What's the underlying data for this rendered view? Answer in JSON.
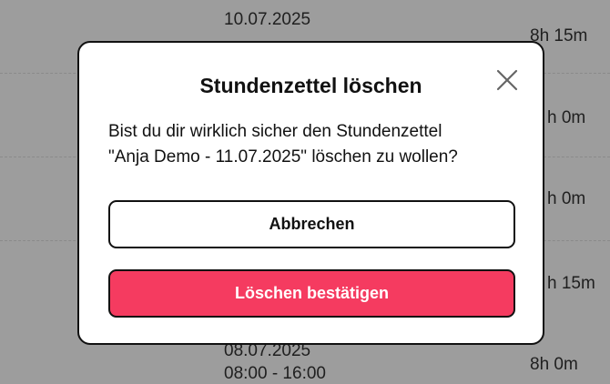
{
  "background": {
    "dates": [
      "10.07.2025",
      "08.07.2025"
    ],
    "time_range": "08:00 - 16:00",
    "durations": [
      "8h 15m",
      "h 0m",
      "h 0m",
      "h 15m",
      "8h 0m"
    ]
  },
  "dialog": {
    "title": "Stundenzettel löschen",
    "message_line1": "Bist du dir wirklich sicher den Stundenzettel",
    "message_line2": "\"Anja Demo - 11.07.2025\" löschen zu wollen?",
    "cancel_label": "Abbrechen",
    "confirm_label": "Löschen bestätigen",
    "close_icon": "close-icon"
  },
  "colors": {
    "overlay": "#9d9d9d",
    "confirm": "#f53b60"
  }
}
